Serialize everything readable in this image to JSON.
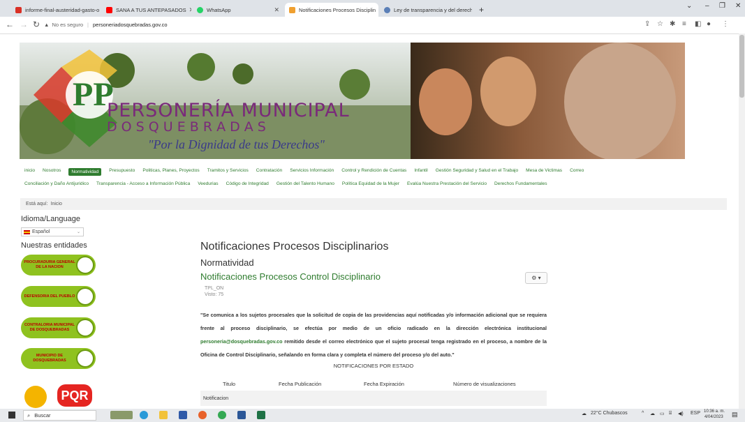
{
  "browser": {
    "tabs": [
      {
        "label": "informe-final-austeridad-gasto-o",
        "icon": "pdf-icon",
        "color": "#d93025"
      },
      {
        "label": "SANA A TUS ANTEPASADOS",
        "icon": "youtube-icon",
        "color": "#ff0000"
      },
      {
        "label": "WhatsApp",
        "icon": "whatsapp-icon",
        "color": "#25d366"
      },
      {
        "label": "Notificaciones Procesos Disciplin",
        "icon": "joomla-icon",
        "color": "#f0a030"
      },
      {
        "label": "Ley de transparencia y del derech",
        "icon": "globe-icon",
        "color": "#5b7fb7"
      }
    ],
    "new_tab": "+",
    "address": {
      "security": "No es seguro",
      "url": "personeriadosquebradas.gov.co"
    }
  },
  "banner": {
    "title_line1": "PERSONERÍA MUNICIPAL",
    "title_line2": "D O S Q U E B R A D A S",
    "slogan": "\"Por la Dignidad de tus Derechos\"",
    "logo_letters": "PP"
  },
  "menu": {
    "row1": [
      "inicio",
      "Nosotros",
      "Normatividad",
      "Presupuesto",
      "Politicas, Planes, Proyectos",
      "Tramitos y Servicios",
      "Contratación",
      "Servicios Información",
      "Control y Rendición de Cuentas",
      "Infantil",
      "Gestión Seguridad y Salud en el Trabajo",
      "Mesa de Victimas",
      "Correo"
    ],
    "row2": [
      "Conciliación y Daño Antijuridico",
      "Transparencia - Acceso a Información Pública",
      "Veedurias",
      "Código de Integridad",
      "Gestión del Talento Humano",
      "Política Equidad de la Mujer",
      "Evalúa Nuestra Prestación del Servicio",
      "Derechos Fundamentales"
    ],
    "active": "Normatividad"
  },
  "breadcrumb": {
    "prefix": "Está aquí:",
    "current": "Inicio"
  },
  "sidebar": {
    "language_heading": "Idioma/Language",
    "language_value": "Español",
    "entities_heading": "Nuestras entidades",
    "entities": [
      "PROCURADURIA GENERAL DE LA NACION",
      "DEFENSORIA DEL PUEBLO",
      "CONTRALORIA MUNICIPAL DE DOSQUEBRADAS",
      "MUNICIPIO DE DOSQUEBRADAS"
    ],
    "pqr_label": "PQR"
  },
  "article": {
    "page_title": "Notificaciones Procesos Disciplinarios",
    "category": "Normatividad",
    "title": "Notificaciones Procesos Control Disciplinario",
    "author": "TPL_ON",
    "hits": "Visto: 75",
    "body_part1": "\"Se comunica a los sujetos procesales que la solicitud de copia de las providencias aquí notificadas y/o información adicional que se requiera frente al proceso disciplinario, se efectúa por medio de un oficio radicado en la dirección electrónica institucional ",
    "email": "personeria@dosquebradas.gov.co",
    "body_part2": " remitido desde el correo electrónico que el sujeto procesal tenga registrado en el proceso, a nombre de la Oficina de Control Disciplinario, señalando en forma clara y completa el número del proceso y/o del auto.\"",
    "notif_heading": "NOTIFICACIONES POR ESTADO",
    "table_headers": [
      "Titulo",
      "Fecha Publicación",
      "Fecha Expiración",
      "Número de visualizaciones"
    ],
    "table_rows": [
      [
        "Notificacion"
      ]
    ]
  },
  "taskbar": {
    "search": "Buscar",
    "weather": "22°C  Chubascos",
    "lang": "ESP",
    "time": "10:36 a. m.",
    "date": "4/04/2023"
  },
  "colors": {
    "accent_green": "#2f7c2f",
    "entity_green": "#8fc21f"
  }
}
